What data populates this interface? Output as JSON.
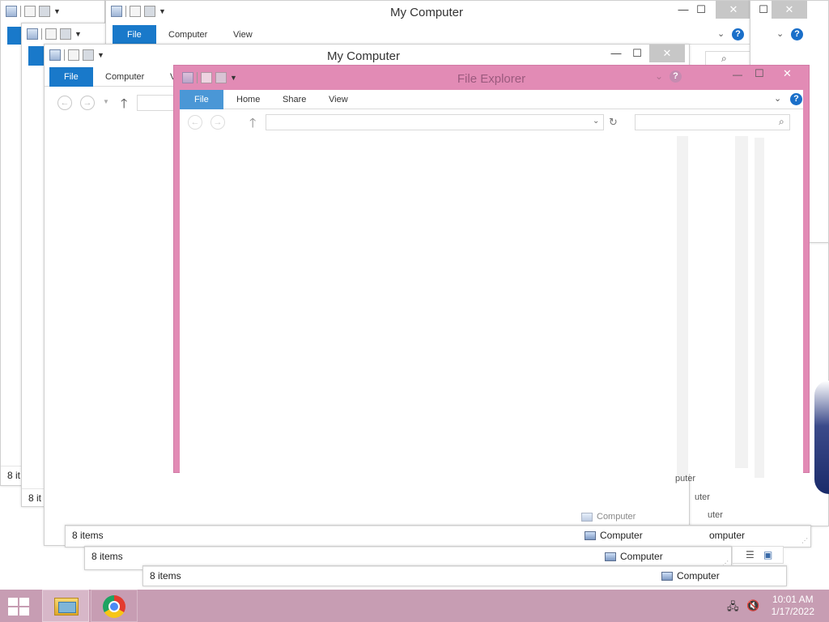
{
  "window_title": "My Computer",
  "active_title": "File Explorer",
  "tabs": {
    "file": "File",
    "computer": "Computer",
    "view": "View",
    "home": "Home",
    "share": "Share"
  },
  "caption": {
    "minimize": "—",
    "maximize": "☐",
    "close": "✕"
  },
  "help": "?",
  "status": {
    "items": "8 items",
    "items_clipped": "8 it",
    "location": "Computer",
    "loc_partial_1": "puter",
    "loc_partial_2": "uter",
    "loc_partial_3": "omputer"
  },
  "clock": {
    "time": "10:01 AM",
    "date": "1/17/2022"
  },
  "colors": {
    "file_tab": "#1979ca",
    "active_frame": "#e28bb5",
    "taskbar": "#c79db3"
  }
}
